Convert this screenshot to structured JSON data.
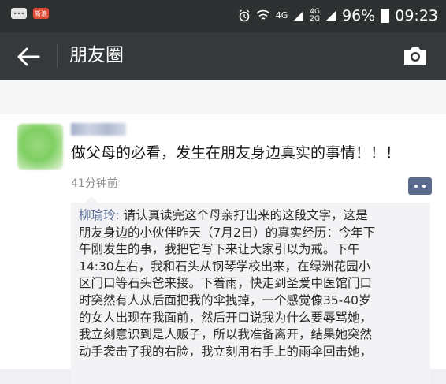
{
  "status_bar": {
    "app_icon_text": "新浪",
    "signal_1": "4G",
    "signal_2_top": "4G",
    "signal_2_bottom": "2G",
    "battery": "96%",
    "time": "09:23"
  },
  "nav": {
    "title": "朋友圈"
  },
  "post": {
    "text": "做父母的必看，发生在朋友身边真实的事情！！！",
    "time": "41分钟前",
    "comment": {
      "author": "柳瑜玲:",
      "lines": [
        "请认真读完这个母亲打出来的这段文字，这是",
        "朋友身边的小伙伴昨天（7月2日）的真实经历：今年下",
        "午刚发生的事，我把它写下来让大家引以为戒。下午",
        "14:30左右，我和石头从钢琴学校出来，在绿洲花园小",
        "区门口等石头爸来接。下着雨，快走到圣爱中医馆门口",
        "时突然有人从后面把我的伞拽掉，一个感觉像35-40岁",
        "的女人出现在我面前，然后开口说我为什么要辱骂她，",
        "我立刻意识到是人贩子，所以我准备离开，结果她突然",
        "动手袭击了我的右脸，我立刻用右手上的雨伞回击她，"
      ]
    }
  },
  "colors": {
    "status_bar": "#2e3132",
    "nav_bar": "#36393b",
    "link": "#576b95"
  }
}
